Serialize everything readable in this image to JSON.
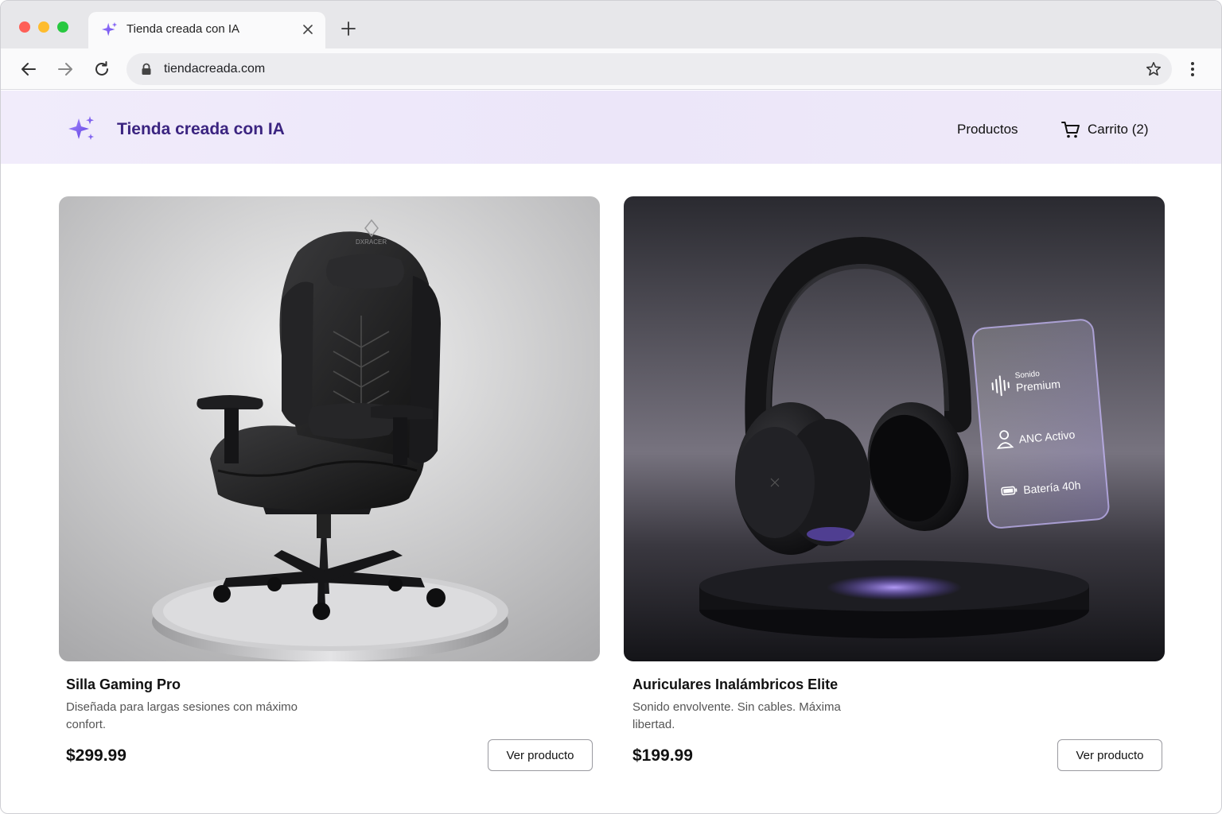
{
  "browser": {
    "tab_title": "Tienda creada con IA",
    "url": "tiendacreada.com"
  },
  "header": {
    "brand": "Tienda creada con IA",
    "nav_products": "Productos",
    "cart_label": "Carrito (2)"
  },
  "products": [
    {
      "name": "Silla Gaming Pro",
      "description": "Diseñada para largas sesiones con máximo confort.",
      "price": "$299.99",
      "button": "Ver producto",
      "image_text": "DXRACER"
    },
    {
      "name": "Auriculares Inalámbricos Elite",
      "description": "Sonido envolvente. Sin cables. Máxima libertad.",
      "price": "$199.99",
      "button": "Ver producto",
      "badge": {
        "sound_small": "Sonido",
        "sound_big": "Premium",
        "anc": "ANC Activo",
        "battery": "Batería 40h"
      }
    }
  ],
  "colors": {
    "accent": "#7b5cf0",
    "brand_text": "#3b2480",
    "header_bg": "#efeaf9"
  }
}
